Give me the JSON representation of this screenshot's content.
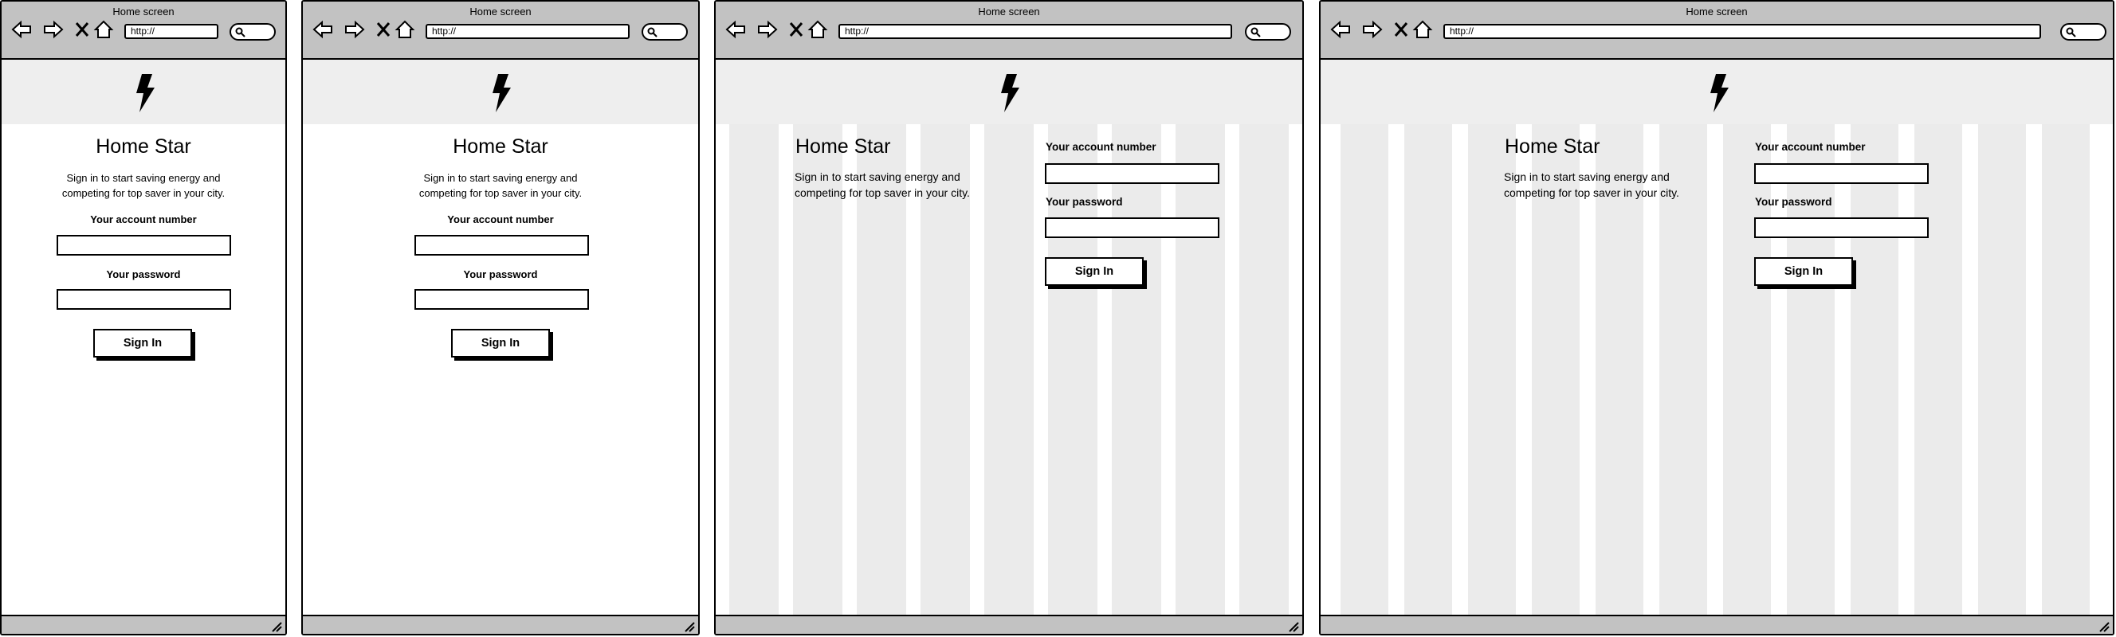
{
  "window": {
    "title": "Home screen",
    "url": "http://"
  },
  "icons": {
    "back": "arrow-left-icon",
    "forward": "arrow-right-icon",
    "stop": "close-icon",
    "home": "home-icon",
    "search": "search-icon",
    "brand": "lightning-bolt-icon",
    "resize": "resize-grip-icon"
  },
  "app": {
    "title": "Home Star",
    "description_line1": "Sign in to start saving energy and",
    "description_line2": "competing for top saver in your city.",
    "account_label": "Your account number",
    "account_value": "",
    "password_label": "Your password",
    "password_value": "",
    "sign_in": "Sign In"
  },
  "colors": {
    "chrome": "#c2c2c2",
    "brand_band": "#eeeeee",
    "grid_column": "#ebebeb"
  }
}
